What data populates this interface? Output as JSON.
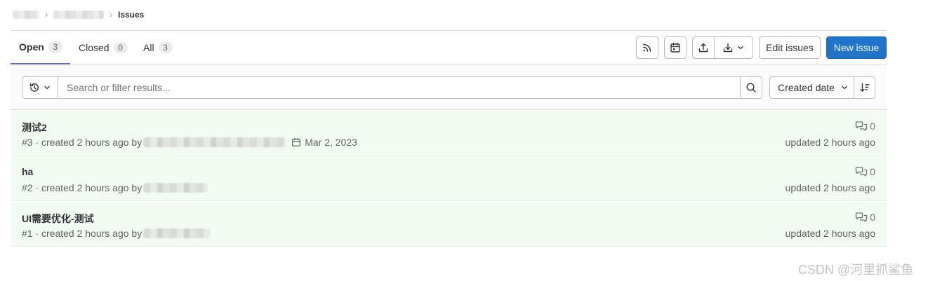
{
  "breadcrumb": {
    "current": "Issues"
  },
  "tabs": [
    {
      "label": "Open",
      "count": "3"
    },
    {
      "label": "Closed",
      "count": "0"
    },
    {
      "label": "All",
      "count": "3"
    }
  ],
  "toolbar": {
    "edit_label": "Edit issues",
    "new_label": "New issue"
  },
  "filter": {
    "placeholder": "Search or filter results...",
    "sort_label": "Created date"
  },
  "issues": [
    {
      "title": "测试2",
      "meta": "#3 · created 2 hours ago by",
      "due": "Mar 2, 2023",
      "comments": "0",
      "updated": "updated 2 hours ago"
    },
    {
      "title": "ha",
      "meta": "#2 · created 2 hours ago by",
      "comments": "0",
      "updated": "updated 2 hours ago"
    },
    {
      "title": "UI需要优化-测试",
      "meta": "#1 · created 2 hours ago by",
      "comments": "0",
      "updated": "updated 2 hours ago"
    }
  ],
  "watermark": "CSDN @河里抓鲨鱼",
  "colors": {
    "primary": "#1f75cb",
    "tab_underline": "#6666c4",
    "row_highlight": "#f2fbf2"
  },
  "icons": [
    "rss-icon",
    "calendar-icon",
    "upload-icon",
    "download-icon",
    "history-icon",
    "search-icon",
    "sort-direction-icon",
    "comment-icon",
    "chevron-down-icon"
  ]
}
